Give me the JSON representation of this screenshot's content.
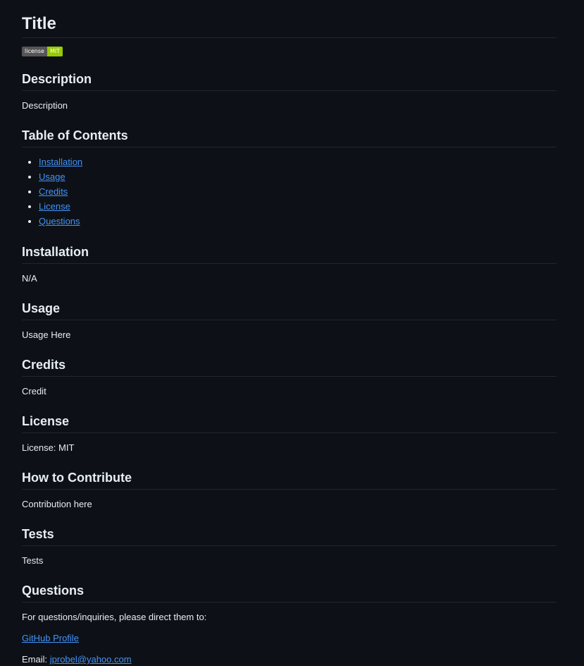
{
  "title": "Title",
  "badge": {
    "left": "license",
    "right": "MIT"
  },
  "description": {
    "heading": "Description",
    "body": "Description"
  },
  "toc": {
    "heading": "Table of Contents",
    "items": [
      "Installation",
      "Usage",
      "Credits",
      "License",
      "Questions"
    ]
  },
  "installation": {
    "heading": "Installation",
    "body": "N/A"
  },
  "usage": {
    "heading": "Usage",
    "body": "Usage Here"
  },
  "credits": {
    "heading": "Credits",
    "body": "Credit"
  },
  "license": {
    "heading": "License",
    "body": "License: MIT"
  },
  "contribute": {
    "heading": "How to Contribute",
    "body": "Contribution here"
  },
  "tests": {
    "heading": "Tests",
    "body": "Tests"
  },
  "questions": {
    "heading": "Questions",
    "intro": "For questions/inquiries, please direct them to:",
    "github_link": "GitHub Profile",
    "email_label": "Email:",
    "email": "jprobel@yahoo.com"
  },
  "colors": {
    "background": "#0d1117",
    "text": "#e6edf3",
    "link": "#4493f8",
    "badge_left": "#555555",
    "badge_right": "#97ca00"
  }
}
